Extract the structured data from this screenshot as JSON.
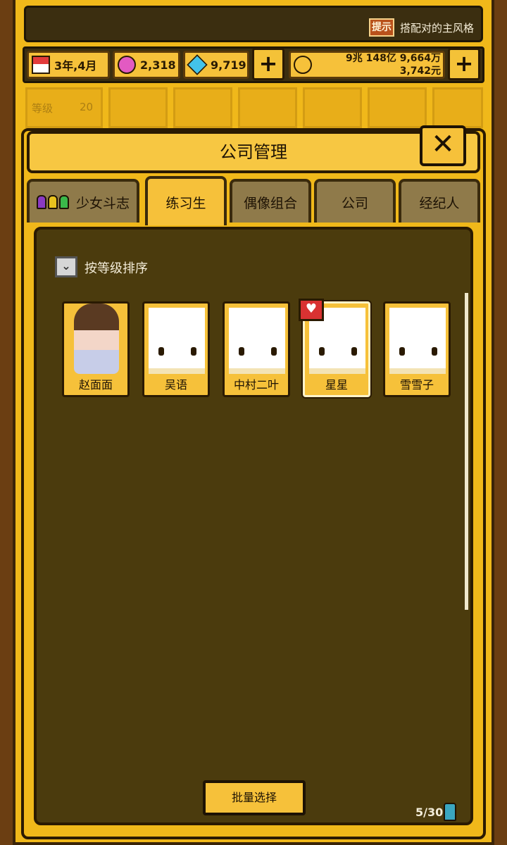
{
  "hint": {
    "badge": "提示",
    "text": "搭配对的主风格"
  },
  "resources": {
    "date": "3年,4月",
    "pink_gems": "2,318",
    "blue_gems": "9,719",
    "money_line1": "9兆 148亿 9,664万",
    "money_line2": "3,742元"
  },
  "background_nav": {
    "level_label": "等级",
    "level_value": "20"
  },
  "panel": {
    "title": "公司管理"
  },
  "tabs": [
    {
      "label": "少女斗志"
    },
    {
      "label": "练习生"
    },
    {
      "label": "偶像组合"
    },
    {
      "label": "公司"
    },
    {
      "label": "经纪人"
    }
  ],
  "active_tab": "练习生",
  "sort": {
    "label": "按等级排序"
  },
  "trainees": [
    {
      "name": "赵面面"
    },
    {
      "name": "吴语"
    },
    {
      "name": "中村二叶"
    },
    {
      "name": "星星"
    },
    {
      "name": "雪雪子"
    }
  ],
  "batch_button": "批量选择",
  "count": "5/30",
  "colors": {
    "gold": "#f6c13a",
    "dark_brown": "#4b3b0d",
    "accent_red": "#d93232"
  }
}
